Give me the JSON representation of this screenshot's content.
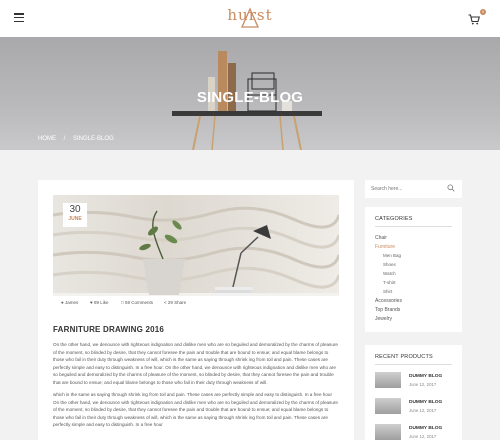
{
  "header": {
    "logo_text": "hurst",
    "cart_count": "0"
  },
  "hero": {
    "title": "SINGLE-BLOG",
    "breadcrumb": [
      "HOME",
      "/",
      "SINGLE-BLOG"
    ]
  },
  "post": {
    "date_day": "30",
    "date_month": "JUNE",
    "meta": {
      "author": "James",
      "likes": "89 Like",
      "comments": "59 Comments",
      "shares": "29 Share"
    },
    "title": "FARNITURE DRAWING 2016",
    "paragraphs": [
      "On the other hand, we denounce with righteous indignation and dislike men who are so beguiled and demoralized by the charms of pleasure of the moment, so blinded by desire, that they cannot foresee the pain and trouble that are bound to ensue; and equal blame belongs to those who fail in their duty through weakness of will, which is the same as saying through shrink ing from toil and pain. These cases are perfectly simple and easy to distinguish. In a free hour. On the other hand, we denounce with righteous indignation and dislike men who are so beguiled and demoralized by the charms of pleasure of the moment, so blinded by desire, that they cannot foresee the pain and trouble that are bound to ensue; and equal blame belongs to those who fail in their duty through weakness of will.",
      "which is the same as saying through shrink ing from toil and pain. These cases are perfectly simple and easy to distinguish. In a free hour On the other hand, we denounce with righteous indignation and dislike men who are so beguiled and demoralized by the charms of pleasure of the moment, so blinded by desire, that they cannot foresee the pain and trouble that are bound to ensue; and equal blame belongs to those who fail in their duty through weakness of will, which is the same as saying through shrink ing from toil and pain. These cases are perfectly simple and easy to distinguish. In a free hour"
    ]
  },
  "sidebar": {
    "search_placeholder": "Search here...",
    "categories_title": "CATEGORIES",
    "categories": [
      {
        "label": "Chair",
        "level": 0,
        "active": false
      },
      {
        "label": "Furniture",
        "level": 0,
        "active": true
      },
      {
        "label": "Men Bag",
        "level": 1,
        "active": false
      },
      {
        "label": "Shoes",
        "level": 1,
        "active": false
      },
      {
        "label": "Watch",
        "level": 1,
        "active": false
      },
      {
        "label": "T-shirt",
        "level": 1,
        "active": false
      },
      {
        "label": "Shirt",
        "level": 1,
        "active": false
      },
      {
        "label": "Accessories",
        "level": 0,
        "active": false
      },
      {
        "label": "Top Brands",
        "level": 0,
        "active": false
      },
      {
        "label": "Jewelry",
        "level": 0,
        "active": false
      }
    ],
    "recent_title": "RECENT PRODUCTS",
    "recent": [
      {
        "title": "DUMMY BLOG",
        "date": "June 12, 2017"
      },
      {
        "title": "DUMMY BLOG",
        "date": "June 12, 2017"
      },
      {
        "title": "DUMMY BLOG",
        "date": "June 12, 2017"
      }
    ]
  },
  "colors": {
    "accent": "#c98a5e",
    "page_bg": "#f2f2f2"
  }
}
